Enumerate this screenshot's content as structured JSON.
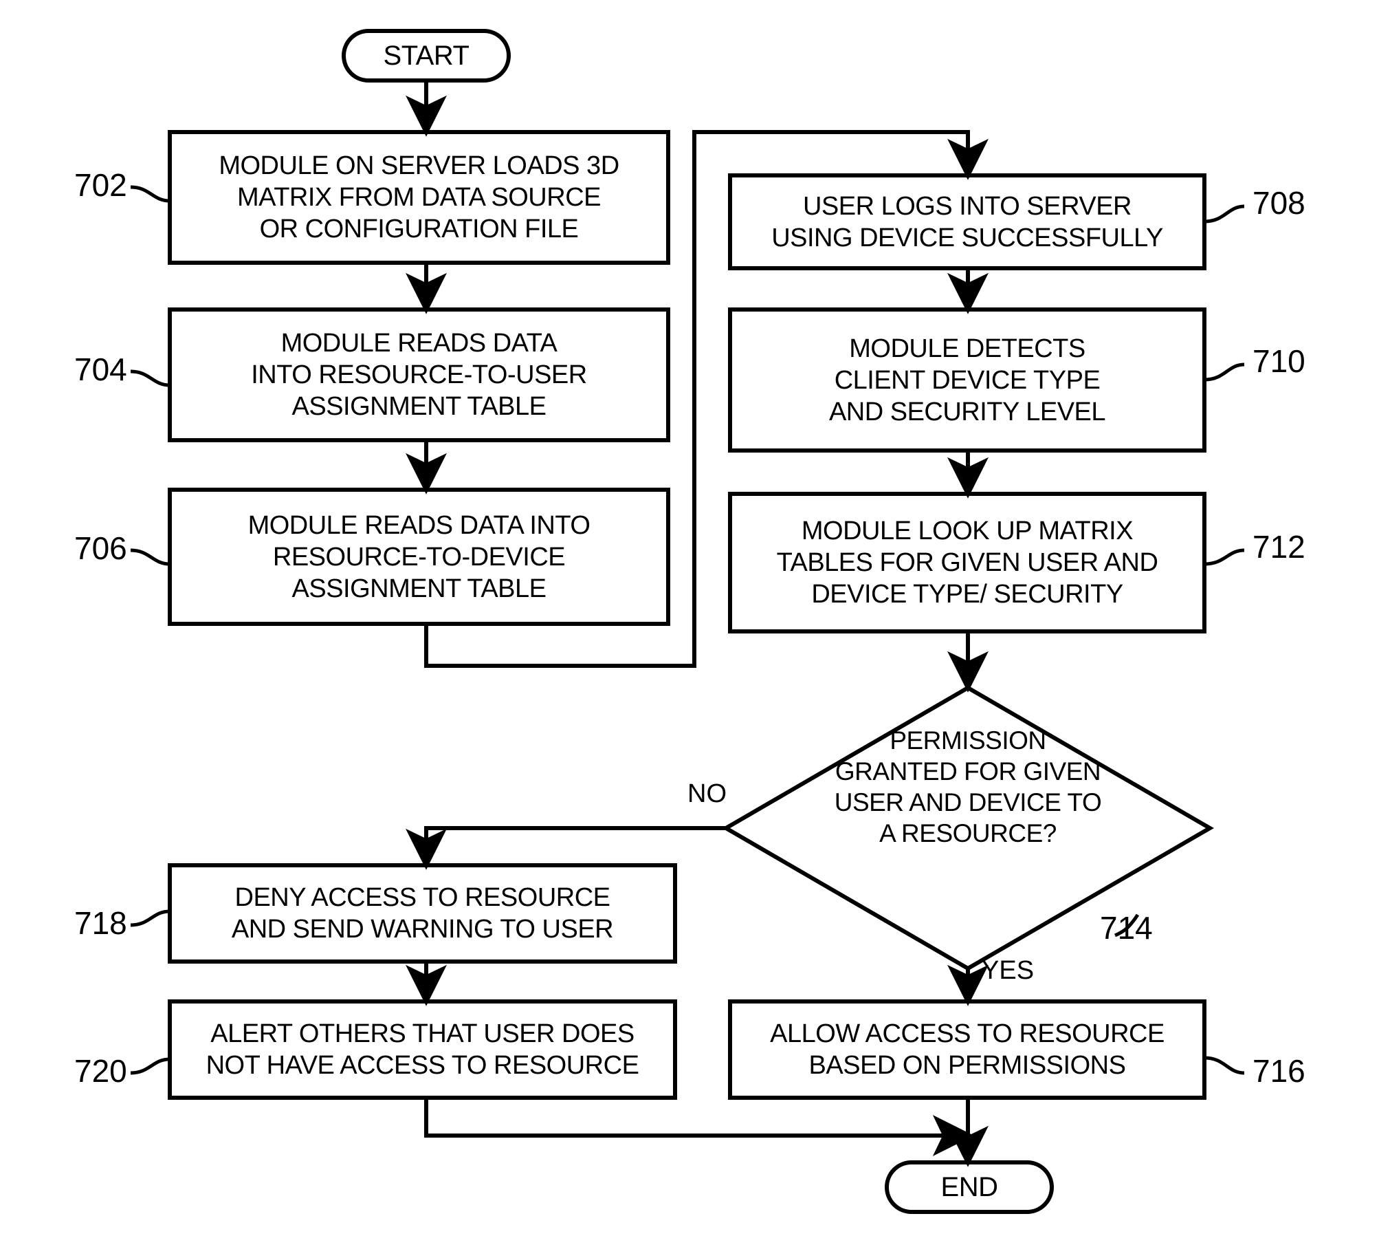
{
  "diagram": {
    "type": "flowchart",
    "title": "",
    "nodes": [
      {
        "id": "start",
        "shape": "terminator",
        "lines": [
          "START"
        ],
        "ref": ""
      },
      {
        "id": "n702",
        "shape": "process",
        "lines": [
          "MODULE ON SERVER LOADS 3D",
          "MATRIX FROM DATA SOURCE",
          "OR CONFIGURATION FILE"
        ],
        "ref": "702"
      },
      {
        "id": "n704",
        "shape": "process",
        "lines": [
          "MODULE READS DATA",
          "INTO RESOURCE-TO-USER",
          "ASSIGNMENT TABLE"
        ],
        "ref": "704"
      },
      {
        "id": "n706",
        "shape": "process",
        "lines": [
          "MODULE READS DATA INTO",
          "RESOURCE-TO-DEVICE",
          "ASSIGNMENT TABLE"
        ],
        "ref": "706"
      },
      {
        "id": "n708",
        "shape": "process",
        "lines": [
          "USER LOGS INTO SERVER",
          "USING DEVICE SUCCESSFULLY"
        ],
        "ref": "708"
      },
      {
        "id": "n710",
        "shape": "process",
        "lines": [
          "MODULE DETECTS",
          "CLIENT DEVICE TYPE",
          "AND SECURITY LEVEL"
        ],
        "ref": "710"
      },
      {
        "id": "n712",
        "shape": "process",
        "lines": [
          "MODULE LOOK UP MATRIX",
          "TABLES FOR GIVEN USER AND",
          "DEVICE TYPE/ SECURITY"
        ],
        "ref": "712"
      },
      {
        "id": "n714",
        "shape": "decision",
        "lines": [
          "PERMISSION",
          "GRANTED FOR GIVEN",
          "USER AND DEVICE TO",
          "A RESOURCE?"
        ],
        "ref": "714"
      },
      {
        "id": "n716",
        "shape": "process",
        "lines": [
          "ALLOW ACCESS TO RESOURCE",
          "BASED ON PERMISSIONS"
        ],
        "ref": "716"
      },
      {
        "id": "n718",
        "shape": "process",
        "lines": [
          "DENY ACCESS TO RESOURCE",
          "AND SEND WARNING TO USER"
        ],
        "ref": "718"
      },
      {
        "id": "n720",
        "shape": "process",
        "lines": [
          "ALERT OTHERS THAT USER DOES",
          "NOT HAVE ACCESS TO RESOURCE"
        ],
        "ref": "720"
      },
      {
        "id": "end",
        "shape": "terminator",
        "lines": [
          "END"
        ],
        "ref": ""
      }
    ],
    "edge_labels": {
      "no": "NO",
      "yes": "YES"
    },
    "reference_numerals": [
      "702",
      "704",
      "706",
      "708",
      "710",
      "712",
      "714",
      "716",
      "718",
      "720"
    ],
    "colors": {
      "stroke": "#000000",
      "fill": "#ffffff",
      "text": "#000000"
    }
  }
}
